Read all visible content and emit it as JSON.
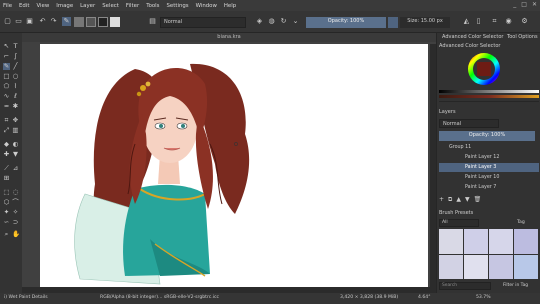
{
  "menu": [
    "File",
    "Edit",
    "View",
    "Image",
    "Layer",
    "Select",
    "Filter",
    "Tools",
    "Settings",
    "Window",
    "Help"
  ],
  "window_controls": [
    "_",
    "□",
    "✕"
  ],
  "toolbar": {
    "blend_mode": "Normal",
    "opacity_label": "Opacity: 100%",
    "size_label": "Size: 15.00 px",
    "tabs": [
      "Advanced Color Selector",
      "Tool Options"
    ]
  },
  "document": {
    "title": "biana.kra"
  },
  "color_selector": {
    "title": "Advanced Color Selector"
  },
  "layers": {
    "title": "Layers",
    "blend_mode": "Normal",
    "opacity_label": "Opacity: 100%",
    "rows": [
      {
        "name": "Group 11",
        "selected": false
      },
      {
        "name": "Paint Layer 12",
        "selected": false
      },
      {
        "name": "Paint Layer 3",
        "selected": true
      },
      {
        "name": "Paint Layer 10",
        "selected": false
      },
      {
        "name": "Paint Layer 7",
        "selected": false
      }
    ]
  },
  "brush_presets": {
    "title": "Brush Presets",
    "all_label": "All",
    "tag_label": "Tag",
    "search_placeholder": "Search",
    "filter_label": "Filter in Tag"
  },
  "status": {
    "brush": "i) Wet Paint Details",
    "color_info": "RGB/Alpha (8-bit integer)... sRGB-elle-V2-srgbtrc.icc",
    "dimensions": "3,420 × 3,828 (38.9 MiB)",
    "rotation": "4.64°",
    "zoom": "53.7%"
  },
  "colors": {
    "accent": "#4f6480",
    "fg": "#1a1a1a",
    "bg": "#ffffff"
  }
}
